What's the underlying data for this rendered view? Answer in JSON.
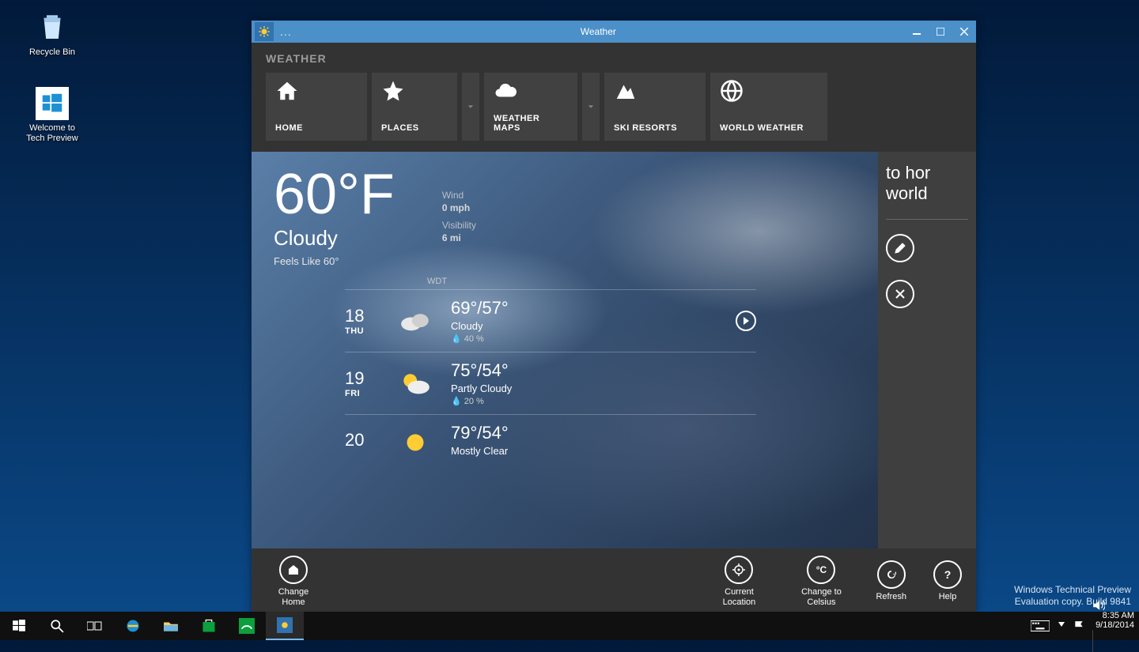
{
  "desktop": {
    "recycle": "Recycle Bin",
    "welcome": "Welcome to Tech Preview"
  },
  "window": {
    "title": "Weather",
    "dotdot": "..."
  },
  "nav": {
    "header": "WEATHER",
    "tiles": [
      {
        "label": "HOME"
      },
      {
        "label": "PLACES"
      },
      {
        "label": "WEATHER MAPS"
      },
      {
        "label": "SKI RESORTS"
      },
      {
        "label": "WORLD WEATHER"
      }
    ]
  },
  "current": {
    "temp": "60°F",
    "condition": "Cloudy",
    "feels": "Feels Like 60°",
    "wind_label": "Wind",
    "wind_val": "0 mph",
    "vis_label": "Visibility",
    "vis_val": "6 mi",
    "provider": "WDT"
  },
  "forecast": [
    {
      "daynum": "18",
      "dayname": "THU",
      "hilo": "69°/57°",
      "cond": "Cloudy",
      "precip": "40 %"
    },
    {
      "daynum": "19",
      "dayname": "FRI",
      "hilo": "75°/54°",
      "cond": "Partly Cloudy",
      "precip": "20 %"
    },
    {
      "daynum": "20",
      "dayname": "",
      "hilo": "79°/54°",
      "cond": "Mostly Clear",
      "precip": ""
    }
  ],
  "sidepanel": {
    "line1": "to hor",
    "line2": "world"
  },
  "appbar": {
    "change_home": "Change Home",
    "current_loc": "Current Location",
    "celsius": "Change to Celsius",
    "refresh": "Refresh",
    "help": "Help"
  },
  "watermark": {
    "line1": "Windows Technical Preview",
    "line2": "Evaluation copy. Build 9841"
  },
  "tray": {
    "time": "8:35 AM",
    "date": "9/18/2014"
  }
}
